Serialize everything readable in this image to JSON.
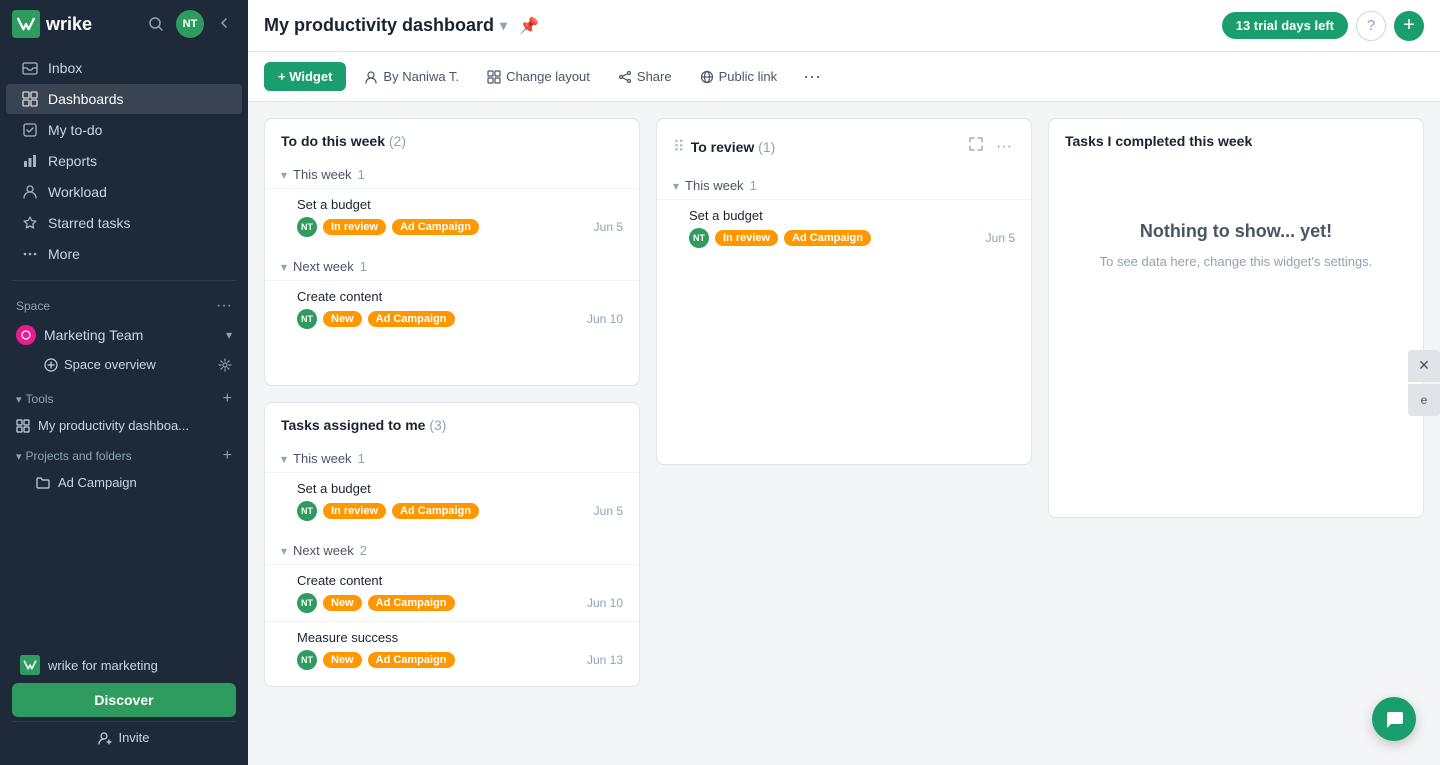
{
  "app": {
    "logo": "wrike",
    "trial_badge": "13 trial days left"
  },
  "sidebar": {
    "avatar_initials": "NT",
    "nav_items": [
      {
        "id": "inbox",
        "label": "Inbox",
        "icon": "inbox"
      },
      {
        "id": "dashboards",
        "label": "Dashboards",
        "icon": "grid",
        "active": true
      },
      {
        "id": "my-todo",
        "label": "My to-do",
        "icon": "check"
      },
      {
        "id": "reports",
        "label": "Reports",
        "icon": "bar-chart"
      },
      {
        "id": "workload",
        "label": "Workload",
        "icon": "people"
      },
      {
        "id": "starred",
        "label": "Starred tasks",
        "icon": "star"
      },
      {
        "id": "more",
        "label": "More",
        "icon": "dots"
      }
    ],
    "space_label": "Space",
    "space_name": "Marketing Team",
    "space_overview": "Space overview",
    "tools_label": "Tools",
    "tools_items": [
      {
        "id": "my-prod-dash",
        "label": "My productivity dashboa..."
      }
    ],
    "projects_label": "Projects and folders",
    "projects": [
      {
        "id": "ad-campaign",
        "label": "Ad Campaign"
      }
    ],
    "wrike_for": "wrike for marketing",
    "discover_label": "Discover",
    "invite_label": "Invite"
  },
  "header": {
    "title": "My productivity dashboard",
    "pin_icon": "📌"
  },
  "toolbar": {
    "widget_label": "+ Widget",
    "author_label": "By Naniwa T.",
    "change_layout_label": "Change layout",
    "share_label": "Share",
    "public_link_label": "Public link"
  },
  "widgets": {
    "todo_widget": {
      "title": "To do this week",
      "count": "(2)",
      "groups": [
        {
          "label": "This week",
          "count": "1",
          "tasks": [
            {
              "name": "Set a budget",
              "status": "In review",
              "campaign": "Ad Campaign",
              "date": "Jun 5"
            }
          ]
        },
        {
          "label": "Next week",
          "count": "1",
          "tasks": [
            {
              "name": "Create content",
              "status": "New",
              "campaign": "Ad Campaign",
              "date": "Jun 10"
            }
          ]
        }
      ]
    },
    "review_widget": {
      "title": "To review",
      "count": "(1)",
      "groups": [
        {
          "label": "This week",
          "count": "1",
          "tasks": [
            {
              "name": "Set a budget",
              "status": "In review",
              "campaign": "Ad Campaign",
              "date": "Jun 5"
            }
          ]
        }
      ]
    },
    "completed_widget": {
      "title": "Tasks I completed this week",
      "empty_title": "Nothing to show... yet!",
      "empty_desc": "To see data here, change this widget's settings."
    },
    "assigned_widget": {
      "title": "Tasks assigned to me",
      "count": "(3)",
      "groups": [
        {
          "label": "This week",
          "count": "1",
          "tasks": [
            {
              "name": "Set a budget",
              "status": "In review",
              "campaign": "Ad Campaign",
              "date": "Jun 5"
            }
          ]
        },
        {
          "label": "Next week",
          "count": "2",
          "tasks": [
            {
              "name": "Create content",
              "status": "New",
              "campaign": "Ad Campaign",
              "date": "Jun 10"
            },
            {
              "name": "Measure success",
              "status": "New",
              "campaign": "Ad Campaign",
              "date": "Jun 13"
            }
          ]
        }
      ]
    }
  }
}
